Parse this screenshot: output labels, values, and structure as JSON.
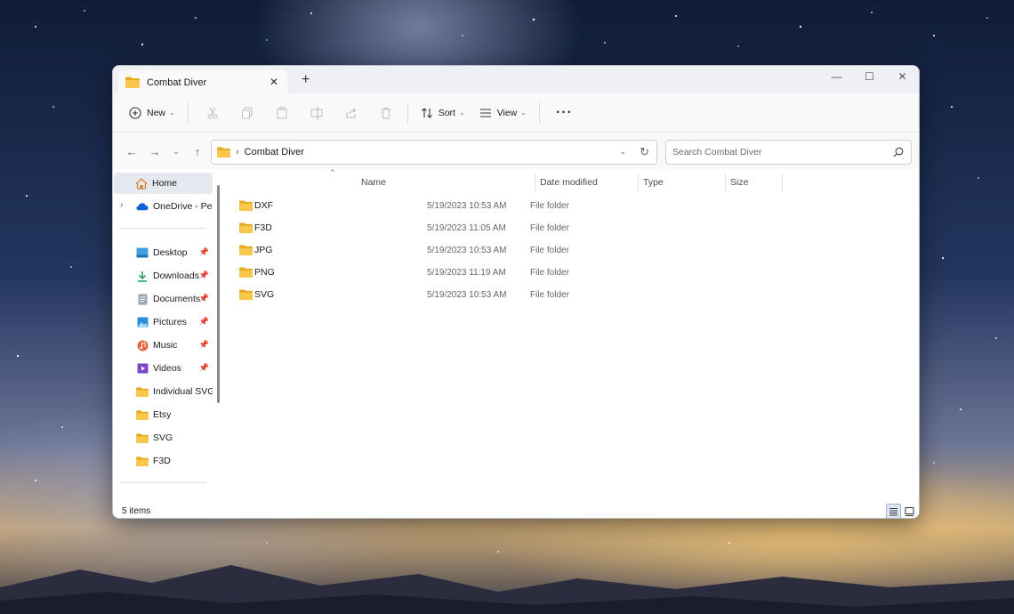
{
  "window": {
    "tab_title": "Combat Diver",
    "new_tab": "+",
    "controls": {
      "minimize": "—",
      "maximize": "☐",
      "close": "✕"
    }
  },
  "toolbar": {
    "new_label": "New",
    "sort_label": "Sort",
    "view_label": "View",
    "more": "···",
    "icons": [
      "cut-icon",
      "copy-icon",
      "paste-icon",
      "rename-icon",
      "share-icon",
      "delete-icon"
    ]
  },
  "nav": {
    "back": "←",
    "forward": "→",
    "recent": "⌄",
    "up": "↑",
    "separator": "›",
    "path": "Combat Diver",
    "search_placeholder": "Search Combat Diver"
  },
  "sidebar": {
    "items": [
      {
        "label": "Home",
        "icon": "home-icon"
      },
      {
        "label": "OneDrive - Personal",
        "icon": "onedrive-icon"
      },
      {
        "label": "Desktop",
        "icon": "desktop-icon",
        "pinned": true
      },
      {
        "label": "Downloads",
        "icon": "downloads-icon",
        "pinned": true
      },
      {
        "label": "Documents",
        "icon": "documents-icon",
        "pinned": true
      },
      {
        "label": "Pictures",
        "icon": "pictures-icon",
        "pinned": true
      },
      {
        "label": "Music",
        "icon": "music-icon",
        "pinned": true
      },
      {
        "label": "Videos",
        "icon": "videos-icon",
        "pinned": true
      },
      {
        "label": "Individual SVG",
        "icon": "folder-icon"
      },
      {
        "label": "Etsy",
        "icon": "folder-icon"
      },
      {
        "label": "SVG",
        "icon": "folder-icon"
      },
      {
        "label": "F3D",
        "icon": "folder-icon"
      }
    ],
    "pin_glyph": "📌"
  },
  "columns": [
    "Name",
    "Date modified",
    "Type",
    "Size"
  ],
  "files": [
    {
      "name": "DXF",
      "date": "5/19/2023 10:53 AM",
      "type": "File folder"
    },
    {
      "name": "F3D",
      "date": "5/19/2023 11:05 AM",
      "type": "File folder"
    },
    {
      "name": "JPG",
      "date": "5/19/2023 10:53 AM",
      "type": "File folder"
    },
    {
      "name": "PNG",
      "date": "5/19/2023 11:19 AM",
      "type": "File folder"
    },
    {
      "name": "SVG",
      "date": "5/19/2023 10:53 AM",
      "type": "File folder"
    }
  ],
  "status": {
    "items_count": "5 items"
  },
  "colors": {
    "folder": "#F8C74B",
    "folder_dark": "#E6A919",
    "onedrive": "#0A64D8",
    "selected": "#E5E8EE"
  }
}
